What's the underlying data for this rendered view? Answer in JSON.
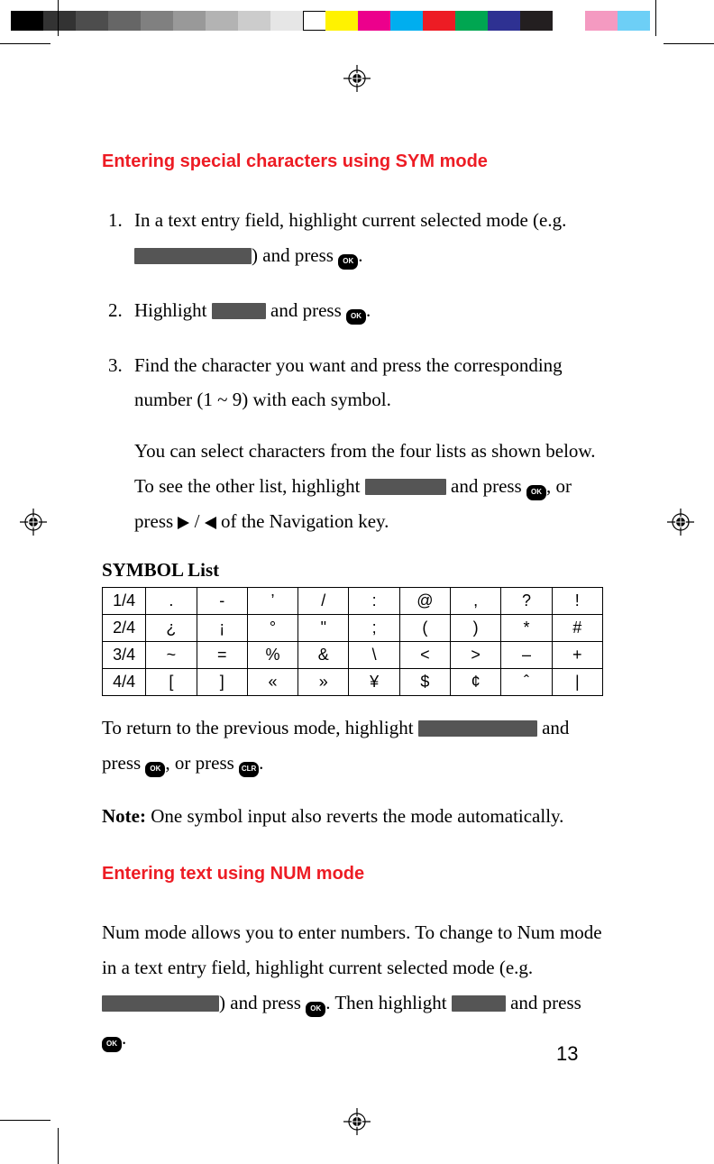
{
  "section1": {
    "heading": "Entering special characters using SYM mode",
    "step1_a": "In a text entry field, highlight current selected mode (e.g.",
    "step1_b": ") and press ",
    "step1_c": ".",
    "step2_a": "Highlight ",
    "step2_b": " and press ",
    "step2_c": ".",
    "step3_a": "Find the character you want and press the corresponding number (1 ~ 9) with each symbol.",
    "step3_b": "You can select characters from the four lists as shown below. To see the other list, highlight ",
    "step3_c": " and press ",
    "step3_d": ", or press ",
    "step3_e": " / ",
    "step3_f": " of the Navigation key."
  },
  "symbol_table": {
    "heading": "SYMBOL List",
    "rows": [
      {
        "label": "1/4",
        "cells": [
          ".",
          "-",
          "’",
          "/",
          ":",
          "@",
          ",",
          "?",
          "!"
        ]
      },
      {
        "label": "2/4",
        "cells": [
          "¿",
          "¡",
          "°",
          "\"",
          ";",
          "(",
          ")",
          "*",
          "#"
        ]
      },
      {
        "label": "3/4",
        "cells": [
          "~",
          "=",
          "%",
          "&",
          "\\",
          "<",
          ">",
          "–",
          "+"
        ]
      },
      {
        "label": "4/4",
        "cells": [
          "[",
          "]",
          "«",
          "»",
          "¥",
          "$",
          "¢",
          "ˆ",
          "|"
        ]
      }
    ]
  },
  "after_table": {
    "a": "To return to the previous mode, highlight ",
    "b": " and press ",
    "c": ", or press ",
    "d": "."
  },
  "note": {
    "label": "Note:",
    "text": " One symbol input also reverts the mode automatically."
  },
  "section2": {
    "heading": "Entering text using NUM mode",
    "a": "Num mode allows you to enter numbers. To change to Num mode in a text entry field, highlight current selected mode (e.g.",
    "b": ") and press ",
    "c": ". Then highlight ",
    "d": " and press ",
    "e": "."
  },
  "buttons": {
    "ok": "OK",
    "clr": "CLR"
  },
  "page_number": "13",
  "colorbars": {
    "left": [
      "#000000",
      "#333333",
      "#4d4d4d",
      "#666666",
      "#808080",
      "#999999",
      "#b3b3b3",
      "#cccccc",
      "#e6e6e6",
      "#ffffff"
    ],
    "right": [
      "#fff200",
      "#ec008c",
      "#00aeef",
      "#ed1c24",
      "#00a651",
      "#2e3192",
      "#231f20",
      "#ffffff",
      "#f49ac1",
      "#6dcff6"
    ]
  }
}
